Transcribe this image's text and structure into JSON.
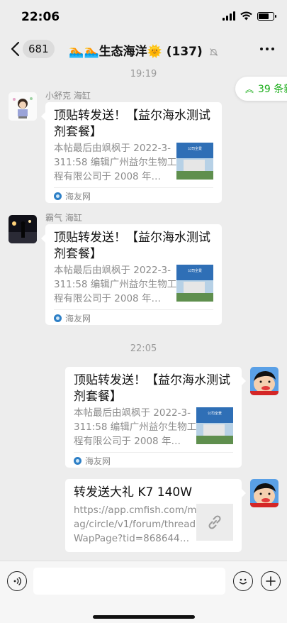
{
  "status_bar": {
    "time": "22:06"
  },
  "nav": {
    "back_count": "681",
    "title": "🏊🏊生态海洋🌞 (137)",
    "icons": {
      "back": "chevron-left-icon",
      "mute": "bell-muted-icon",
      "more": "more-icon"
    }
  },
  "unread": {
    "label": "39 条新",
    "icon": "double-chevron-up-icon",
    "color": "#1aad19"
  },
  "timestamps": [
    "19:19",
    "22:05"
  ],
  "messages": [
    {
      "sender": "小舒克 海缸",
      "side": "left",
      "title": "顶贴转发送！【益尔海水测试剂套餐】",
      "desc": "本帖最后由飒枫于 2022-3-311:58 编辑广州益尔生物工程有限公司于 2008 年…",
      "thumb_caption": "公司全景",
      "source": "海友网"
    },
    {
      "sender": "霸气 海缸",
      "side": "left",
      "title": "顶贴转发送！【益尔海水测试剂套餐】",
      "desc": "本帖最后由飒枫于 2022-3-311:58 编辑广州益尔生物工程有限公司于 2008 年…",
      "thumb_caption": "公司全景",
      "source": "海友网"
    },
    {
      "side": "right",
      "title": "顶贴转发送！【益尔海水测试剂套餐】",
      "desc": "本帖最后由飒枫于 2022-3-311:58 编辑广州益尔生物工程有限公司于 2008 年…",
      "thumb_caption": "公司全景",
      "source": "海友网"
    },
    {
      "side": "right",
      "title": "转发送大礼 K7 140W",
      "desc": "https://app.cmfish.com/mag/circle/v1/forum/threadWapPage?tid=868644…",
      "thumb_icon": "link-icon"
    }
  ],
  "input_bar": {
    "icons": {
      "voice": "voice-icon",
      "emoji": "emoji-icon",
      "plus": "plus-icon"
    }
  },
  "colors": {
    "background": "#ededed",
    "card": "#ffffff",
    "accent": "#1aad19"
  }
}
